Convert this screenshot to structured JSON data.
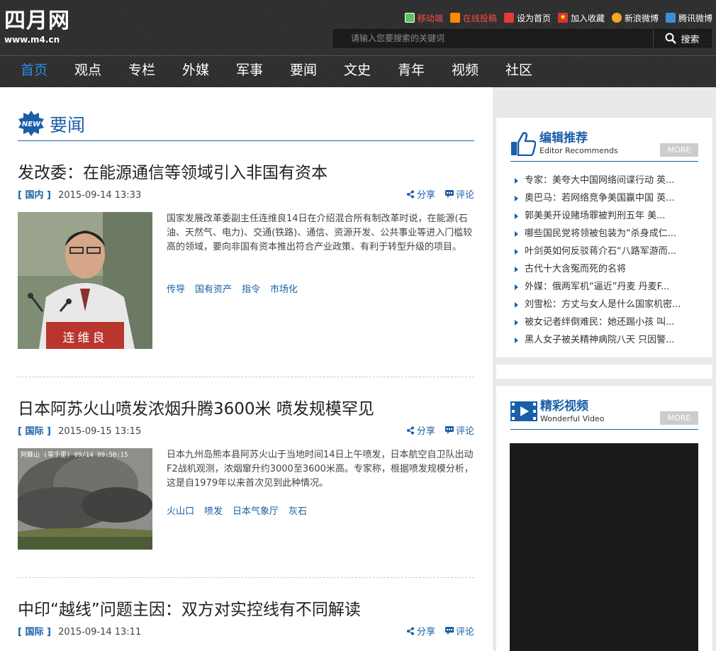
{
  "logo": {
    "cn": "四月网",
    "en": "www.m4.cn"
  },
  "toplinks": [
    {
      "label": "移动端",
      "icon": "mobile-icon",
      "color": "#5ec25e",
      "red": true
    },
    {
      "label": "在线投稿",
      "icon": "pencil-icon",
      "color": "#ff8a00",
      "red": true
    },
    {
      "label": "设为首页",
      "icon": "home-icon",
      "color": "#e03a3a",
      "red": false
    },
    {
      "label": "加入收藏",
      "icon": "star-icon",
      "color": "#d33",
      "red": false
    },
    {
      "label": "新浪微博",
      "icon": "weibo-icon",
      "color": "#f5a623",
      "red": false
    },
    {
      "label": "腾讯微博",
      "icon": "tencent-weibo-icon",
      "color": "#3b8fd9",
      "red": false
    }
  ],
  "search": {
    "placeholder": "请输入您要搜索的关键词",
    "button": "搜索"
  },
  "nav": [
    "首页",
    "观点",
    "专栏",
    "外媒",
    "军事",
    "要闻",
    "文史",
    "青年",
    "视频",
    "社区"
  ],
  "section": {
    "title": "要闻",
    "badge": "NEW"
  },
  "articles": [
    {
      "title": "发改委：在能源通信等领域引入非国有资本",
      "category": "[ 国内 ]",
      "time": "2015-09-14 13:33",
      "share": "分享",
      "comment": "评论",
      "summary": "国家发展改革委副主任连维良14日在介绍混合所有制改革时说，在能源(石油、天然气、电力)、交通(铁路)、通信、资源开发、公共事业等进入门槛较高的领域，要向非国有资本推出符合产业政策、有利于转型升级的项目。",
      "image_caption": "连维良",
      "tags": [
        "传导",
        "国有资产",
        "指令",
        "市场化"
      ]
    },
    {
      "title": "日本阿苏火山喷发浓烟升腾3600米 喷发规模罕见",
      "category": "[ 国际 ]",
      "time": "2015-09-15 13:15",
      "share": "分享",
      "comment": "评论",
      "summary": "日本九州岛熊本县阿苏火山于当地时间14日上午喷发，日本航空自卫队出动F2战机观测，浓烟窜升约3000至3600米高。专家称，根据喷发规模分析，这是自1979年以来首次见到此种情况。",
      "image_caption": "阿蘇山 (草千里)  09/14 09:50:15",
      "tags": [
        "火山口",
        "喷发",
        "日本气象厅",
        "灰石"
      ]
    },
    {
      "title": "中印“越线”问题主因：双方对实控线有不同解读",
      "category": "[ 国际 ]",
      "time": "2015-09-14 13:11",
      "share": "分享",
      "comment": "评论"
    }
  ],
  "editor": {
    "title": "编辑推荐",
    "subtitle": "Editor Recommends",
    "more": "MORE",
    "items": [
      "专家：美夸大中国网络间谍行动 英...",
      "奥巴马：若网络竞争美国赢中国 英...",
      "郭美美开设赌场罪被判刑五年 美...",
      "哪些国民党将领被包装为“杀身成仁...",
      "叶剑英如何反驳蒋介石“八路军游而...",
      "古代十大含冤而死的名将",
      "外媒：俄两军机“逼近”丹麦 丹麦F...",
      "刘雪松：方丈与女人是什么国家机密...",
      "被女记者绊倒难民：她还踢小孩 叫...",
      "黑人女子被关精神病院八天 只因警..."
    ]
  },
  "video": {
    "title": "精彩视频",
    "subtitle": "Wonderful Video",
    "more": "MORE"
  },
  "colors": {
    "accent": "#1a5fa8",
    "nav_active": "#2a8ae6",
    "header_bg": "#2e2e2e"
  }
}
